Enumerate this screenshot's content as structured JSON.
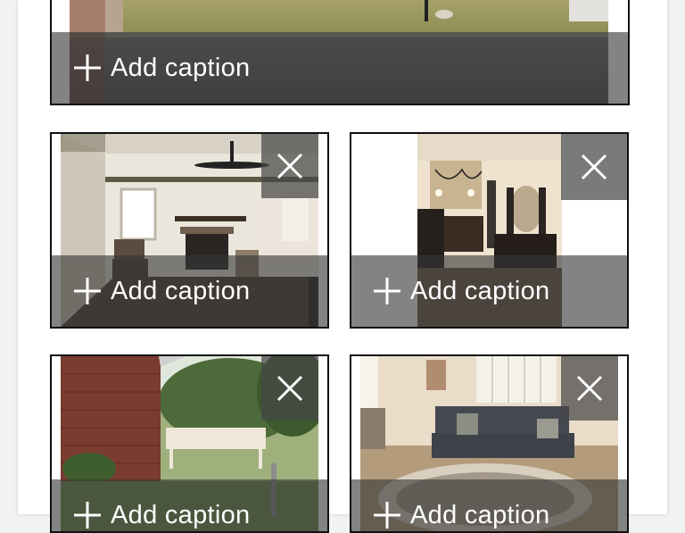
{
  "colors": {
    "tile_border": "#111111",
    "caption_overlay": "#373737",
    "caption_text": "#ffffff",
    "page_background": "#f2f2f2"
  },
  "icons": {
    "add": "plus-icon",
    "remove": "close-icon"
  },
  "photos": [
    {
      "description_key": "front-yard-street",
      "caption_placeholder": "Add caption",
      "has_remove_button": false
    },
    {
      "description_key": "living-room-fireplace",
      "caption_placeholder": "Add caption",
      "has_remove_button": true
    },
    {
      "description_key": "bedroom-vanity-dresser",
      "caption_placeholder": "Add caption",
      "has_remove_button": true
    },
    {
      "description_key": "backyard-deck",
      "caption_placeholder": "Add caption",
      "has_remove_button": true
    },
    {
      "description_key": "living-room-sofa",
      "caption_placeholder": "Add caption",
      "has_remove_button": true
    }
  ]
}
